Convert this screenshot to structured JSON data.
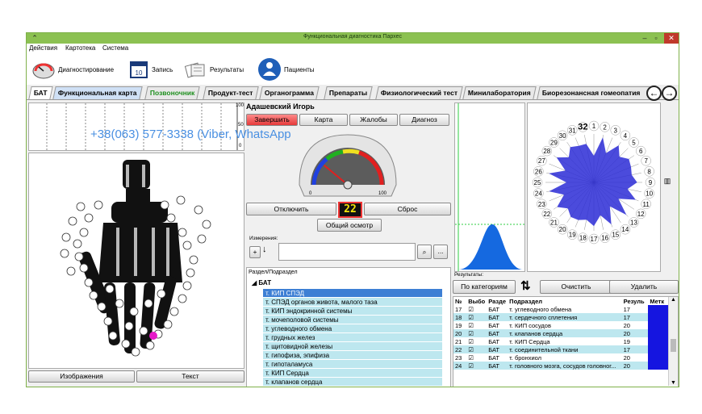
{
  "window": {
    "title": "Функциональная диагностика Пархес"
  },
  "menu": [
    "Действия",
    "Картотека",
    "Система"
  ],
  "toolbar": {
    "diagnostics": "Диагностирование",
    "record": "Запись",
    "results": "Результаты",
    "patients": "Пациенты"
  },
  "tabs": [
    "БАТ",
    "Функциональная карта",
    "Позвоночник",
    "Продукт-тест",
    "Органограмма",
    "Препараты",
    "Физиологический тест",
    "Минилаборатория",
    "Биорезонансная гомеопатия"
  ],
  "watermark": "+38(063) 577-3338 (Viber, WhatsApp",
  "graph_scale": {
    "top": "100",
    "mid": "50",
    "bottom": "0"
  },
  "patient": {
    "name": "Адашевский Игорь"
  },
  "actions": {
    "finish": "Завершить",
    "map": "Карта",
    "complaints": "Жалобы",
    "diagnosis": "Диагноз"
  },
  "gauge": {
    "value": 22,
    "display": "22",
    "min_label": "0",
    "max_label": "100"
  },
  "controls": {
    "off": "Отключить",
    "reset": "Сброс",
    "general": "Общий осмотр"
  },
  "measurements": {
    "label": "Измерения:",
    "add": "+",
    "more": "..."
  },
  "left_buttons": {
    "images": "Изображения",
    "text": "Текст"
  },
  "section_list": {
    "header": "Раздел/Подраздел",
    "group": "БАТ",
    "items": [
      "т. КИП СПЭД",
      "т. СПЭД органов живота, малого таза",
      "т. КИП эндокринной системы",
      "т. мочеполовой системы",
      "т. углеводного обмена",
      "т. грудных желез",
      "т. щитовидной железы",
      "т. гипофиза, эпифиза",
      "т. гипоталамуса",
      "т. КИП Сердца",
      "т. клапанов сердца"
    ]
  },
  "polar": {
    "numbers": [
      "1",
      "2",
      "3",
      "4",
      "5",
      "6",
      "7",
      "8",
      "9",
      "10",
      "11",
      "12",
      "13",
      "14",
      "15",
      "16",
      "17",
      "18",
      "19",
      "20",
      "21",
      "22",
      "23",
      "24",
      "25",
      "26",
      "27",
      "28",
      "29",
      "30",
      "31",
      "32"
    ]
  },
  "results": {
    "label": "Результаты:",
    "by_category": "По категориям",
    "clear": "Очистить",
    "delete": "Удалить",
    "columns": [
      "№",
      "Выбо",
      "Разде",
      "Подраздел",
      "Резуль",
      "Метк"
    ],
    "rows": [
      {
        "n": "17",
        "sec": "БАТ",
        "sub": "т. углеводного обмена",
        "res": "17"
      },
      {
        "n": "18",
        "sec": "БАТ",
        "sub": "т. сердечного сплетения",
        "res": "17"
      },
      {
        "n": "19",
        "sec": "БАТ",
        "sub": "т. КИП сосудов",
        "res": "20"
      },
      {
        "n": "20",
        "sec": "БАТ",
        "sub": "т. клапанов сердца",
        "res": "20"
      },
      {
        "n": "21",
        "sec": "БАТ",
        "sub": "т. КИП Сердца",
        "res": "19"
      },
      {
        "n": "22",
        "sec": "БАТ",
        "sub": "т. соединительной ткани",
        "res": "17"
      },
      {
        "n": "23",
        "sec": "БАТ",
        "sub": "т. бронхиол",
        "res": "20"
      },
      {
        "n": "24",
        "sec": "БАТ",
        "sub": "т. головного мозга, сосудов головног...",
        "res": "20"
      }
    ]
  },
  "colors": {
    "titlebar": "#8cc152",
    "finish": "#e63a3a",
    "selection": "#3d7fd4",
    "list_bg": "#bde7ef",
    "point": "#e619c8",
    "marker": "#1515e0",
    "polar_fill": "#2b2bd6"
  }
}
